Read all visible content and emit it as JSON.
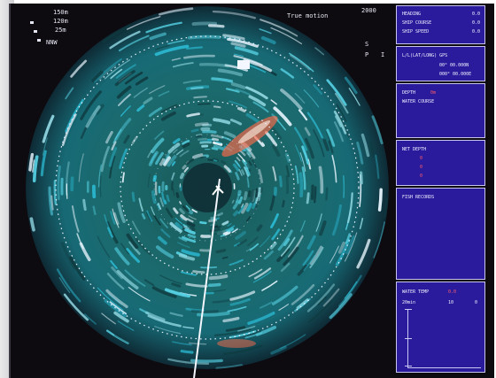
{
  "radar_overlay": {
    "range_rows": [
      "150m",
      "120m",
      "25m"
    ],
    "bearing_text": "NNW",
    "mode_label": "True motion",
    "top_right_value": "2000",
    "status_glyphs": [
      "S",
      "P",
      "I"
    ]
  },
  "panel": {
    "nav": {
      "rows": [
        {
          "label": "HEADING",
          "value": "0.0"
        },
        {
          "label": "SHIP COURSE",
          "value": "0.0"
        },
        {
          "label": "SHIP SPEED",
          "value": "0.0"
        }
      ]
    },
    "position": {
      "title": "L/L(LAT/LONG) GPS",
      "lat": "00° 00.000N",
      "lon": "000° 00.000E"
    },
    "depth": {
      "label": "DEPTH",
      "value": "0m",
      "sub": "WATER COURSE"
    },
    "net_depth": {
      "label": "NET DEPTH",
      "values": [
        "0",
        "0",
        "0"
      ]
    },
    "fish_records": {
      "label": "FISH RECORDS"
    },
    "water_temp": {
      "label": "WATER TEMP",
      "value": "0.0",
      "scale_left": "20min",
      "scale_mid": "10",
      "scale_right": "0"
    }
  },
  "colors": {
    "echo_cyan": "#2bb7cf",
    "echo_white": "#e9f6ff",
    "echo_red": "#ff6b4a",
    "panel_blue": "#2a1a9c",
    "panel_border": "#c7c5ee",
    "bezel": "#0d0b10"
  }
}
